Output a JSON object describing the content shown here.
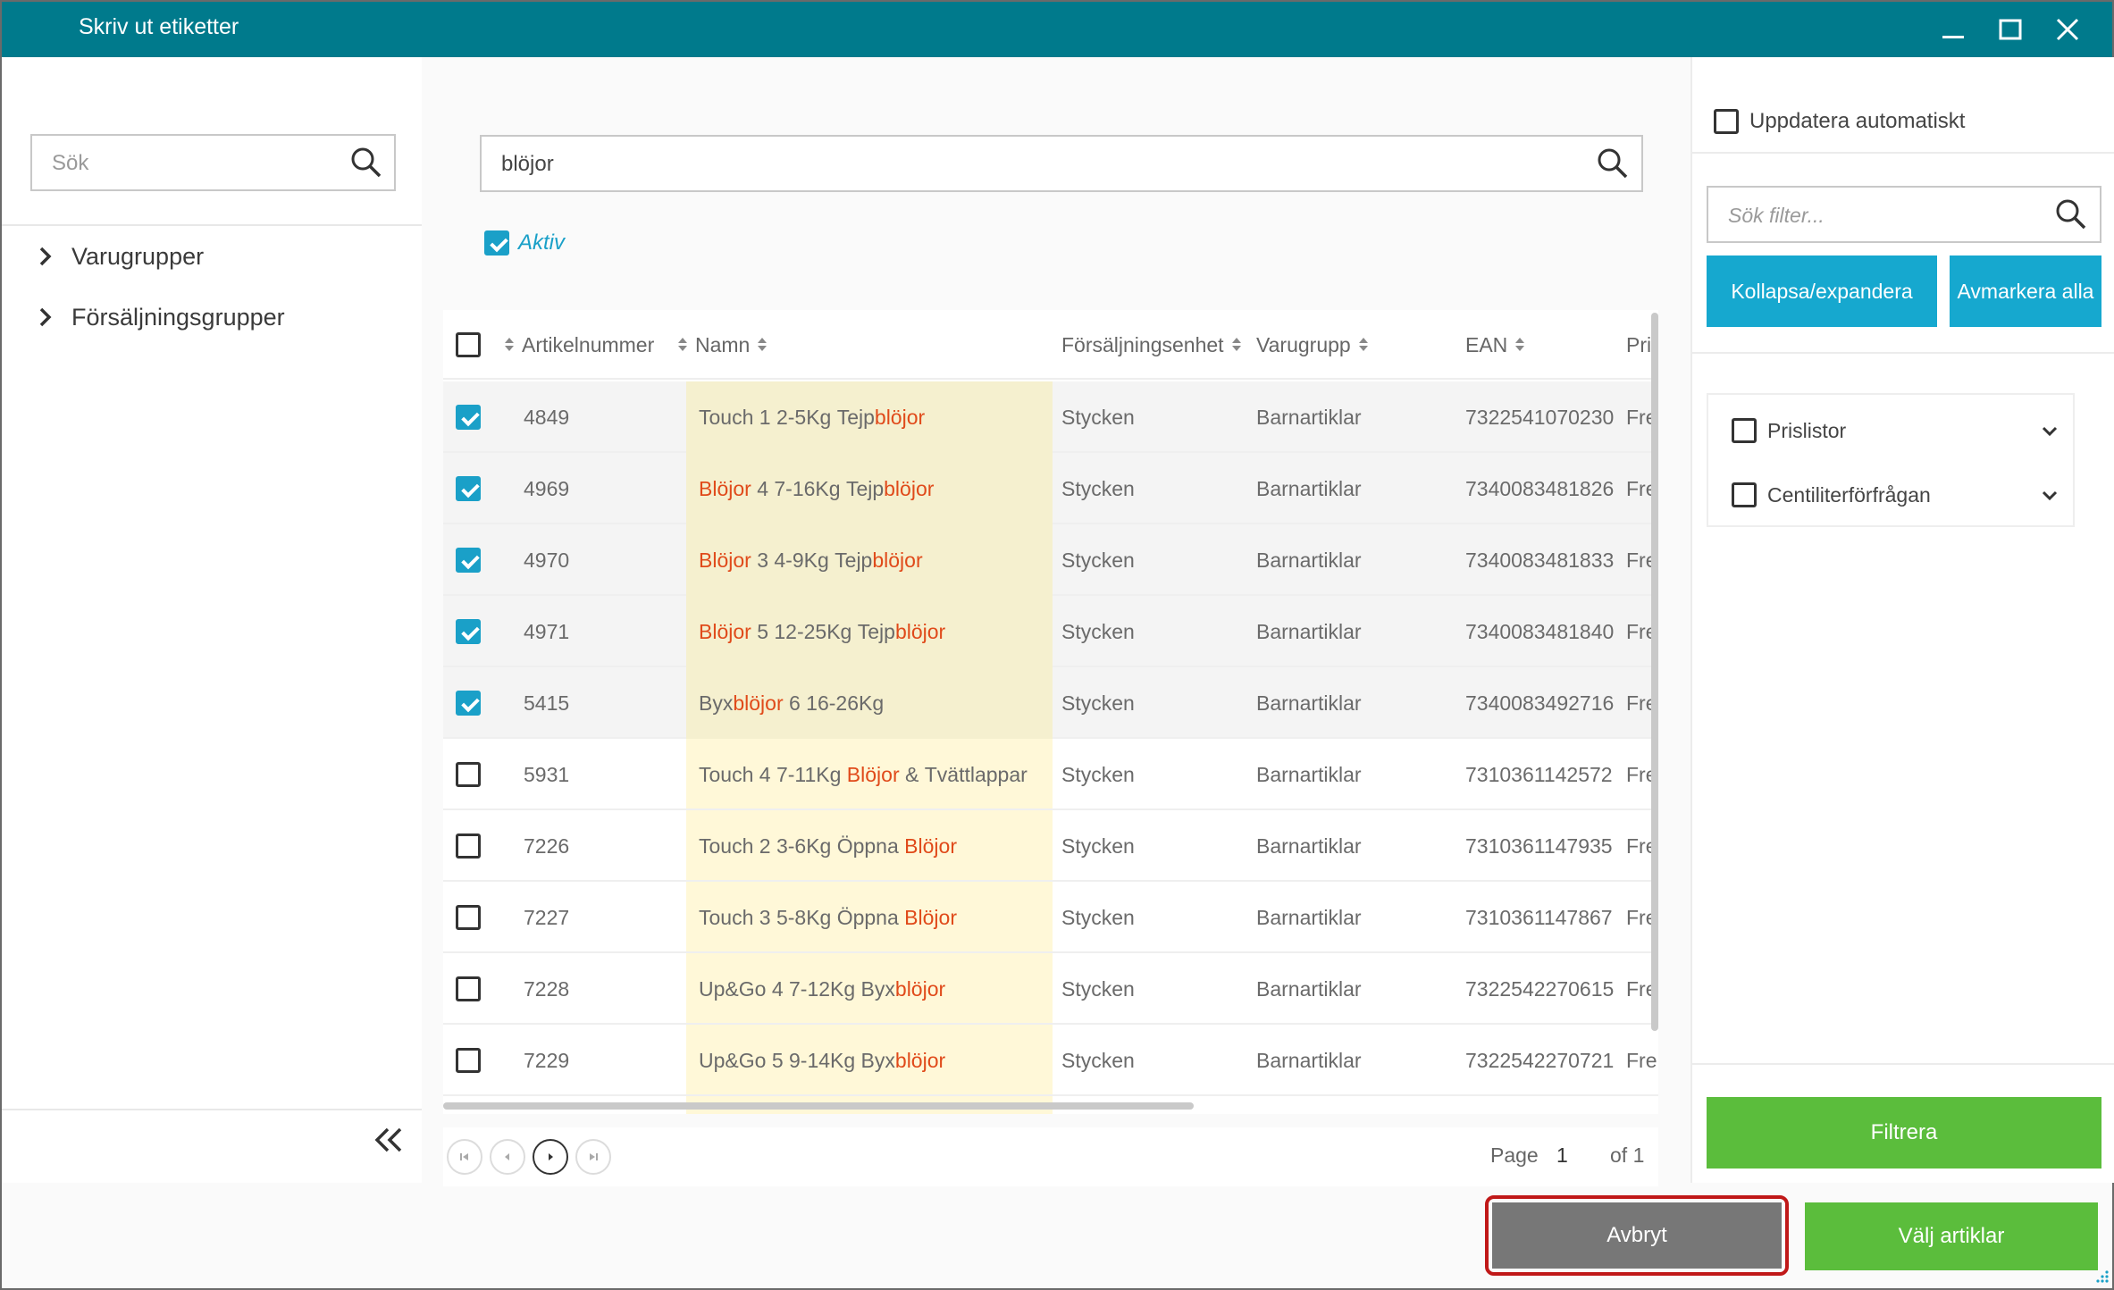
{
  "window": {
    "title": "Skriv ut etiketter",
    "controls": [
      "minimize",
      "maximize",
      "close"
    ]
  },
  "left_panel": {
    "search_placeholder": "Sök",
    "tree": [
      {
        "label": "Varugrupper"
      },
      {
        "label": "Försäljningsgrupper"
      }
    ]
  },
  "main": {
    "search_value": "blöjor",
    "active_filter": {
      "label": "Aktiv",
      "checked": true
    },
    "columns": [
      "Artikelnummer",
      "Namn",
      "Försäljningsenhet",
      "Varugrupp",
      "EAN",
      "Pri"
    ],
    "rows": [
      {
        "checked": true,
        "artnr": "4849",
        "name": [
          [
            "Touch 1 2-5Kg Tejp",
            false
          ],
          [
            "blöjor",
            true
          ]
        ],
        "unit": "Stycken",
        "group": "Barnartiklar",
        "ean": "7322541070230",
        "extra": "Fre"
      },
      {
        "checked": true,
        "artnr": "4969",
        "name": [
          [
            "Blöjor",
            true
          ],
          [
            " 4 7-16Kg Tejp",
            false
          ],
          [
            "blöjor",
            true
          ]
        ],
        "unit": "Stycken",
        "group": "Barnartiklar",
        "ean": "7340083481826",
        "extra": "Fre"
      },
      {
        "checked": true,
        "artnr": "4970",
        "name": [
          [
            "Blöjor",
            true
          ],
          [
            " 3 4-9Kg Tejp",
            false
          ],
          [
            "blöjor",
            true
          ]
        ],
        "unit": "Stycken",
        "group": "Barnartiklar",
        "ean": "7340083481833",
        "extra": "Fre"
      },
      {
        "checked": true,
        "artnr": "4971",
        "name": [
          [
            "Blöjor",
            true
          ],
          [
            " 5 12-25Kg Tejp",
            false
          ],
          [
            "blöjor",
            true
          ]
        ],
        "unit": "Stycken",
        "group": "Barnartiklar",
        "ean": "7340083481840",
        "extra": "Fre"
      },
      {
        "checked": true,
        "artnr": "5415",
        "name": [
          [
            "Byx",
            false
          ],
          [
            "blöjor",
            true
          ],
          [
            " 6 16-26Kg",
            false
          ]
        ],
        "unit": "Stycken",
        "group": "Barnartiklar",
        "ean": "7340083492716",
        "extra": "Fre"
      },
      {
        "checked": false,
        "artnr": "5931",
        "name": [
          [
            "Touch 4 7-11Kg ",
            false
          ],
          [
            "Blöjor",
            true
          ],
          [
            " & Tvättlappar",
            false
          ]
        ],
        "unit": "Stycken",
        "group": "Barnartiklar",
        "ean": "7310361142572",
        "extra": "Fre"
      },
      {
        "checked": false,
        "artnr": "7226",
        "name": [
          [
            "Touch 2 3-6Kg Öppna ",
            false
          ],
          [
            "Blöjor",
            true
          ]
        ],
        "unit": "Stycken",
        "group": "Barnartiklar",
        "ean": "7310361147935",
        "extra": "Fre"
      },
      {
        "checked": false,
        "artnr": "7227",
        "name": [
          [
            "Touch 3 5-8Kg Öppna ",
            false
          ],
          [
            "Blöjor",
            true
          ]
        ],
        "unit": "Stycken",
        "group": "Barnartiklar",
        "ean": "7310361147867",
        "extra": "Fre"
      },
      {
        "checked": false,
        "artnr": "7228",
        "name": [
          [
            "Up&Go 4 7-12Kg Byx",
            false
          ],
          [
            "blöjor",
            true
          ]
        ],
        "unit": "Stycken",
        "group": "Barnartiklar",
        "ean": "7322542270615",
        "extra": "Fre"
      },
      {
        "checked": false,
        "artnr": "7229",
        "name": [
          [
            "Up&Go 5 9-14Kg Byx",
            false
          ],
          [
            "blöjor",
            true
          ]
        ],
        "unit": "Stycken",
        "group": "Barnartiklar",
        "ean": "7322542270721",
        "extra": "Fre"
      }
    ],
    "pager": {
      "page_label": "Page",
      "page": "1",
      "of_label": "of 1"
    }
  },
  "right_panel": {
    "auto_update_label": "Uppdatera automatiskt",
    "filter_placeholder": "Sök filter...",
    "collapse_label": "Kollapsa/expandera",
    "deselect_label": "Avmarkera alla",
    "filters": [
      {
        "label": "Prislistor"
      },
      {
        "label": "Centiliterförfrågan"
      }
    ],
    "filter_button": "Filtrera"
  },
  "footer": {
    "cancel_label": "Avbryt",
    "choose_label": "Välj artiklar"
  },
  "colors": {
    "titlebar": "#007a8c",
    "accent": "#1aa0c8",
    "highlight_text": "#e04a1a",
    "name_column_bg": "#fff8d8",
    "green": "#5bbd3c",
    "cancel_grey": "#777777",
    "cancel_outline": "#c01818"
  }
}
